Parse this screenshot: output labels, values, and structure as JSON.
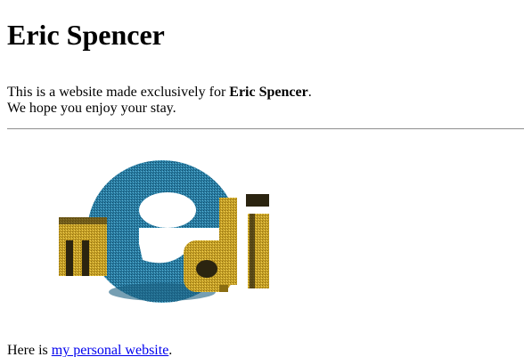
{
  "page": {
    "title": "Eric Spencer",
    "intro_prefix": "This is a website made exclusively for ",
    "intro_bold": "Eric Spencer",
    "intro_suffix": ".",
    "intro_line2": "We hope you enjoy your stay.",
    "logo": {
      "icon": "email-3d-logo-icon",
      "letters": [
        "m",
        "e",
        "a",
        "i",
        "l"
      ],
      "colors": {
        "blue": "#2a7fa6",
        "gold": "#c9a227",
        "dark": "#2b2410"
      }
    },
    "footer_prefix": "Here is ",
    "footer_link": "my personal website",
    "footer_suffix": ".",
    "link_color": "#0000ee"
  }
}
